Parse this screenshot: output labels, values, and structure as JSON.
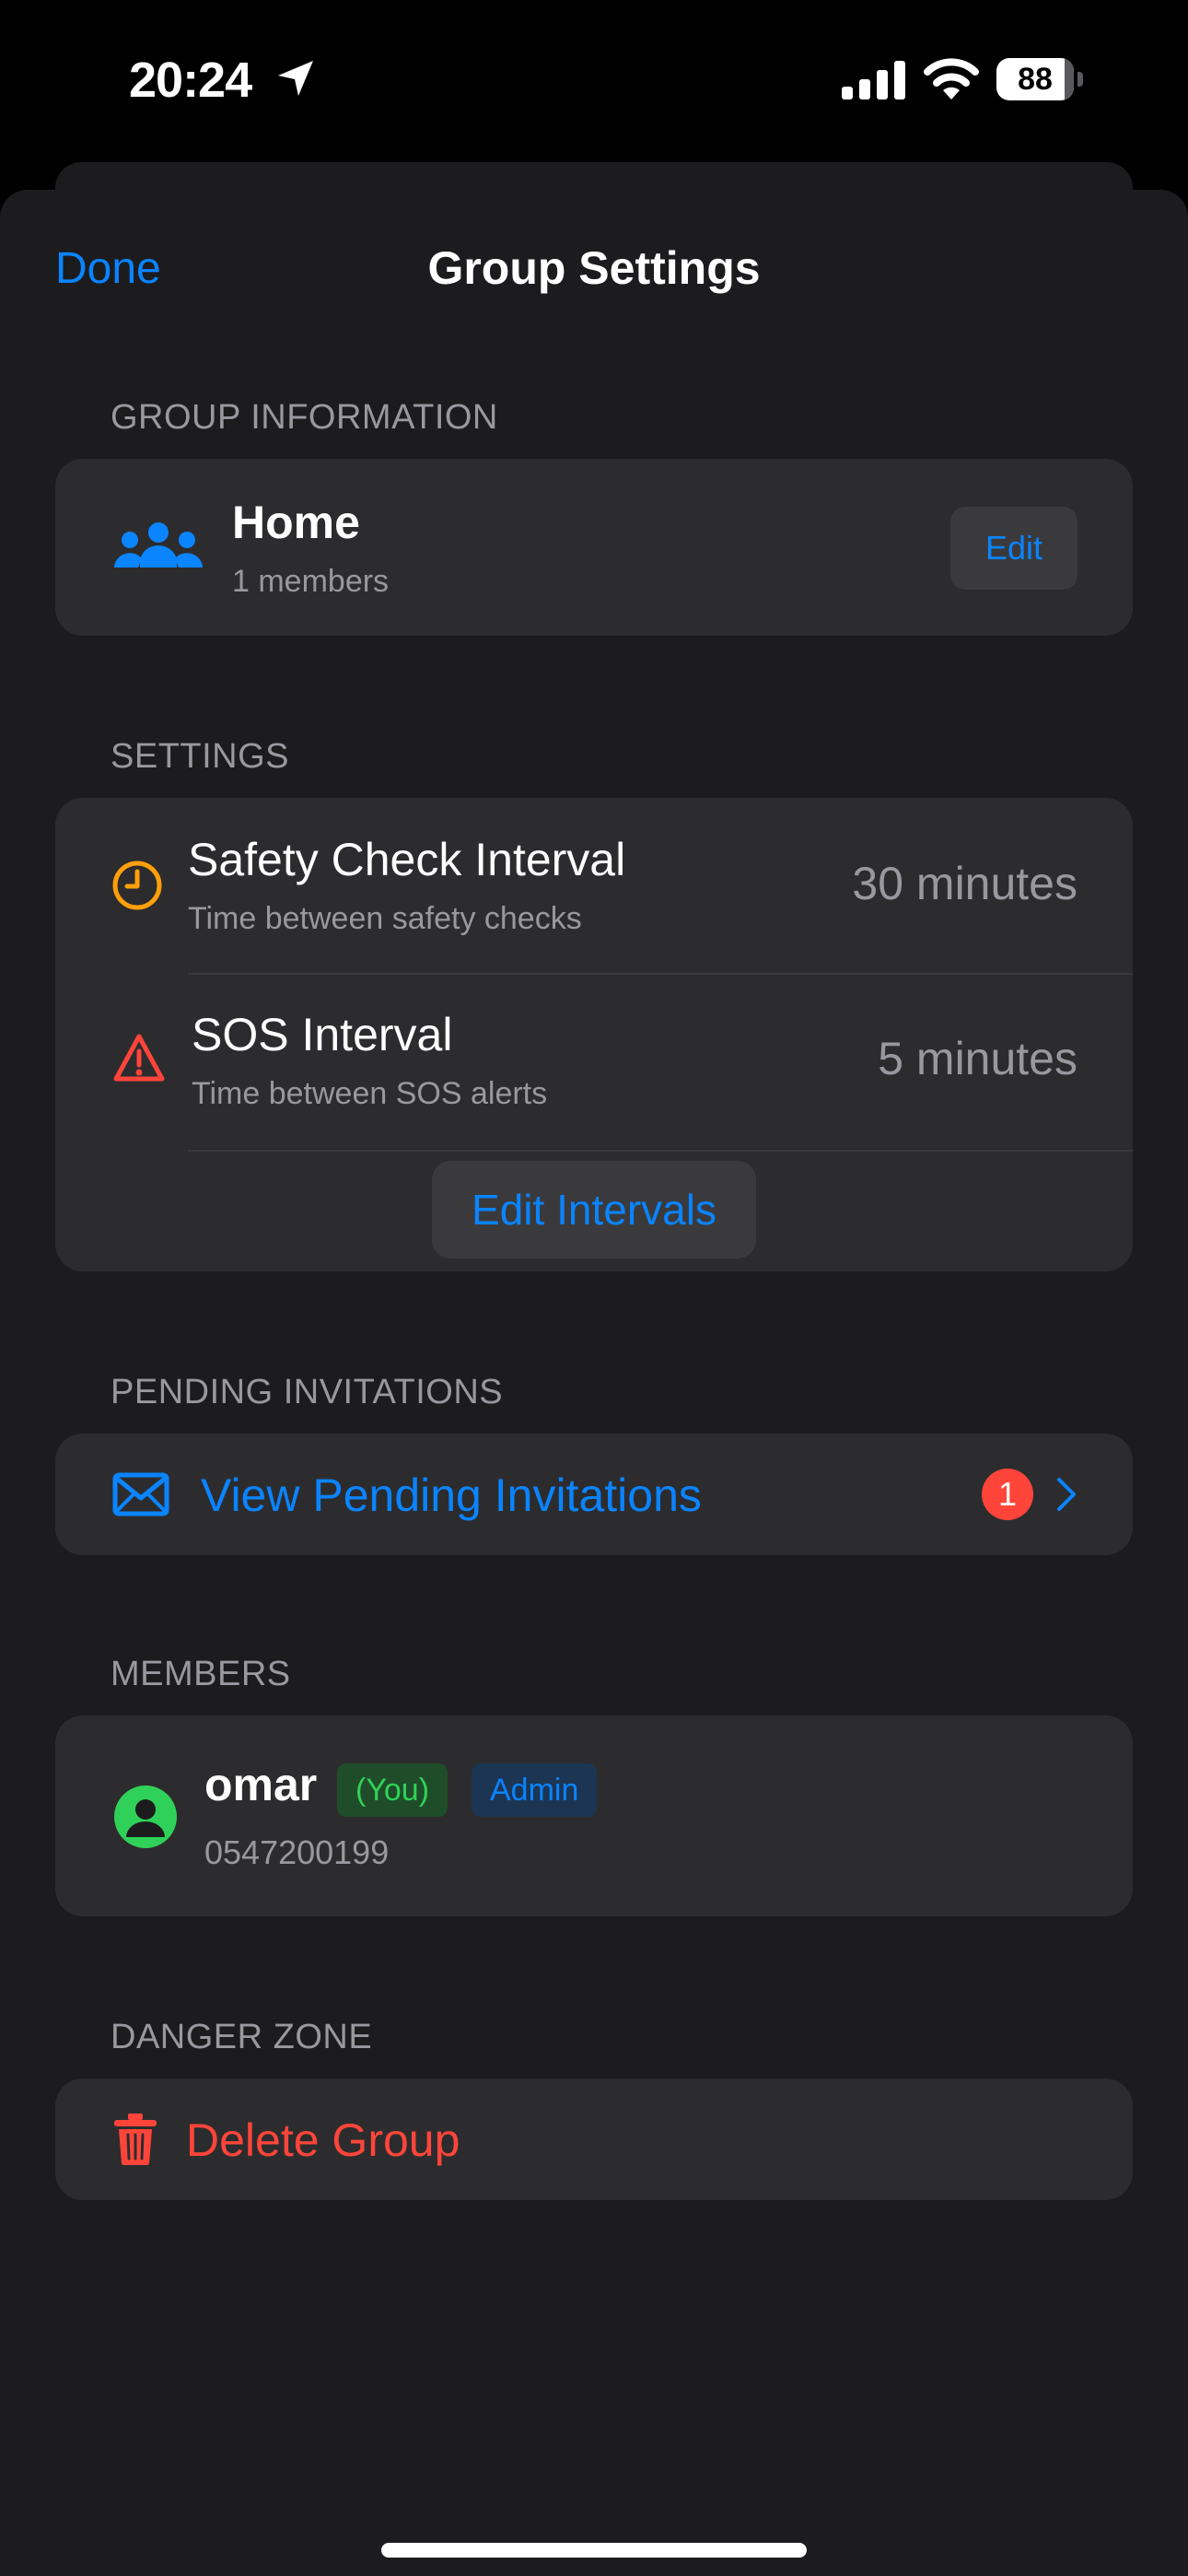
{
  "status_bar": {
    "time": "20:24",
    "battery_level": "88",
    "icons": [
      "location-arrow-icon",
      "signal-icon",
      "wifi-icon",
      "battery-icon"
    ]
  },
  "nav": {
    "done_label": "Done",
    "title": "Group Settings"
  },
  "group_info": {
    "header": "GROUP INFORMATION",
    "name": "Home",
    "members_text": "1 members",
    "edit_label": "Edit",
    "icon": "group-icon"
  },
  "settings": {
    "header": "SETTINGS",
    "rows": [
      {
        "title": "Safety Check Interval",
        "subtitle": "Time between safety checks",
        "value": "30 minutes",
        "icon": "clock-icon"
      },
      {
        "title": "SOS Interval",
        "subtitle": "Time between SOS alerts",
        "value": "5 minutes",
        "icon": "warning-icon"
      }
    ],
    "edit_intervals_label": "Edit Intervals"
  },
  "pending": {
    "header": "PENDING INVITATIONS",
    "label": "View Pending Invitations",
    "badge_count": "1",
    "icon": "envelope-icon"
  },
  "members": {
    "header": "MEMBERS",
    "list": [
      {
        "name": "omar",
        "you_tag": "(You)",
        "role_tag": "Admin",
        "phone": "0547200199"
      }
    ]
  },
  "danger": {
    "header": "DANGER ZONE",
    "delete_label": "Delete Group",
    "icon": "trash-icon"
  },
  "colors": {
    "accent": "#0a84ff",
    "destructive": "#ff453a",
    "success": "#30d158",
    "warning": "#ff9f0a",
    "background": "#1c1c1e",
    "card": "#2c2c2e"
  }
}
